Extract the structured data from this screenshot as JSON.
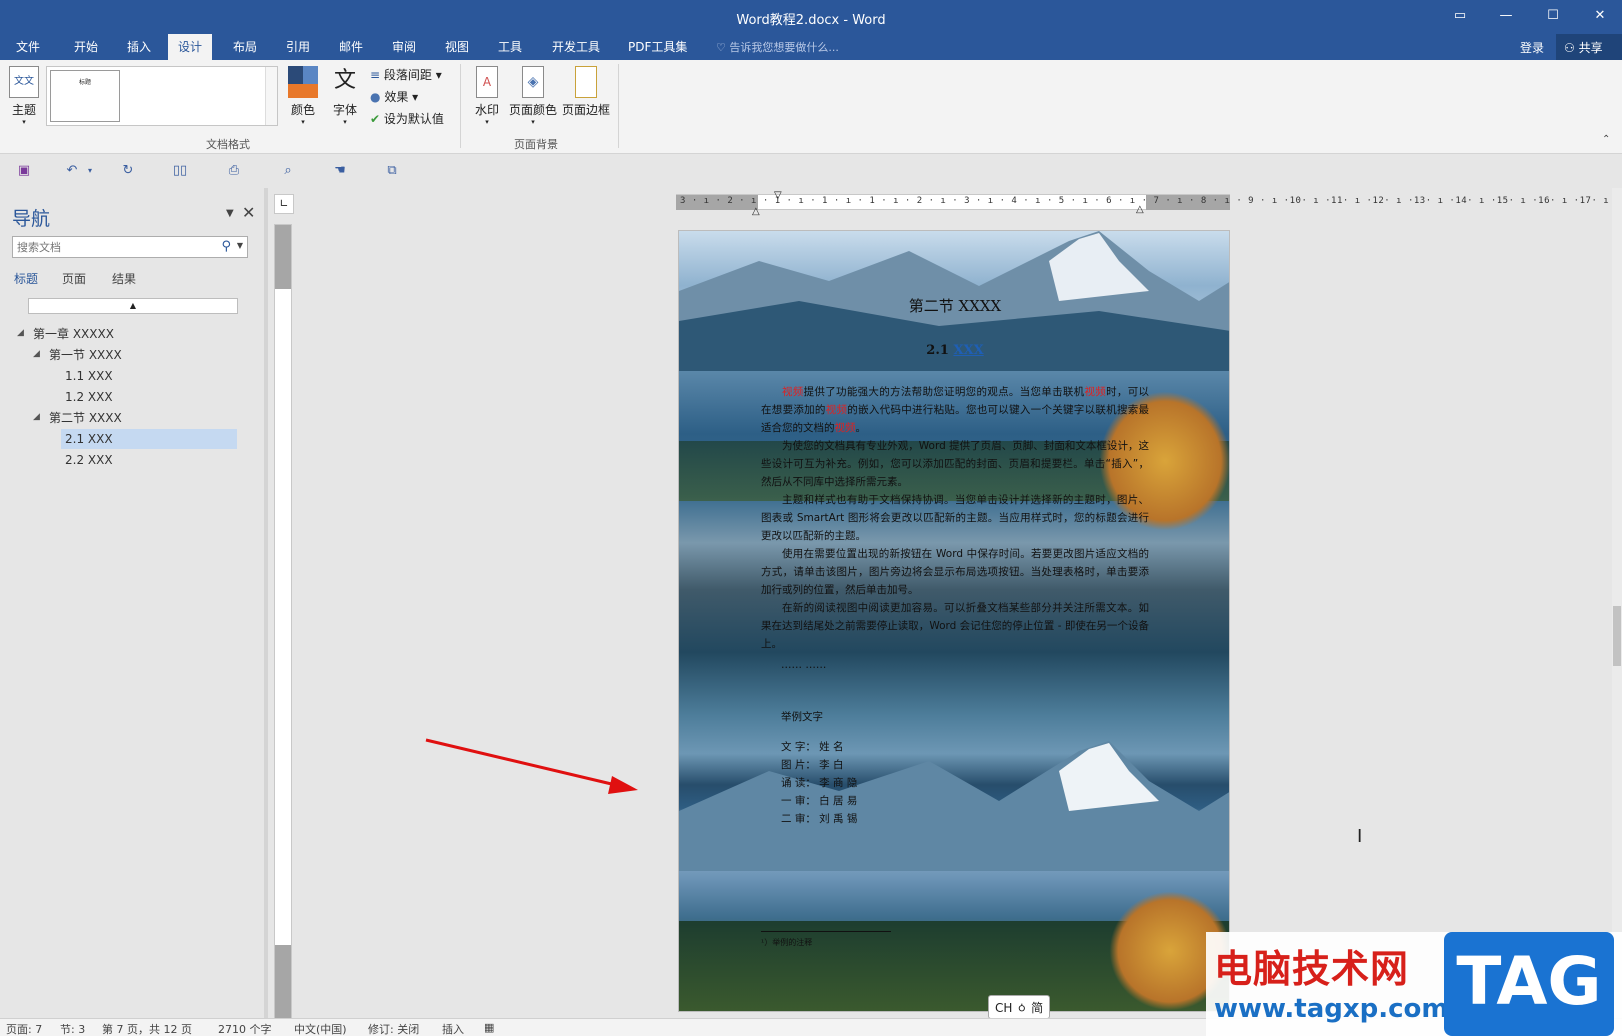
{
  "window": {
    "title": "Word教程2.docx - Word"
  },
  "menu": {
    "items": [
      "文件",
      "开始",
      "插入",
      "设计",
      "布局",
      "引用",
      "邮件",
      "审阅",
      "视图",
      "工具",
      "开发工具",
      "PDF工具集"
    ],
    "active": "设计",
    "tell_me": "告诉我您想要做什么...",
    "login": "登录",
    "share": "共享"
  },
  "ribbon": {
    "theme": "主题",
    "thumb_label": "标题",
    "colors": "颜色",
    "fonts": "字体",
    "para_spacing": "段落间距",
    "effects": "效果",
    "set_default": "设为默认值",
    "group_doc_format": "文档格式",
    "watermark": "水印",
    "page_color": "页面颜色",
    "page_border": "页面边框",
    "group_page_bg": "页面背景"
  },
  "nav": {
    "title": "导航",
    "search_placeholder": "搜索文档",
    "tabs": [
      "标题",
      "页面",
      "结果"
    ],
    "tree": [
      {
        "label": "第一章 XXXXX",
        "level": 0
      },
      {
        "label": "第一节 XXXX",
        "level": 1
      },
      {
        "label": "1.1 XXX",
        "level": 2
      },
      {
        "label": "1.2 XXX",
        "level": 2
      },
      {
        "label": "第二节 XXXX",
        "level": 1
      },
      {
        "label": "2.1 XXX",
        "level": 2,
        "selected": true
      },
      {
        "label": "2.2 XXX",
        "level": 2
      }
    ]
  },
  "ruler": {
    "h_text": "3 · ı · 2 · ı · 1 · ı · 1 · ı · 1 · ı · 2 · ı · 3 · ı · 4 · ı · 5 · ı · 6 · ı · 7 · ı · 8 · ı · 9 · ı ·10· ı ·11· ı ·12· ı ·13· ı ·14· ı ·15· ı ·16· ı ·17· ı ·"
  },
  "document": {
    "heading1": "第二节  XXXX",
    "heading2_num": "2.1 ",
    "heading2_link": "XXX",
    "para1_parts": [
      "视频",
      "提供了功能强大的方法帮助您证明您的观点。当您单击联机",
      "视频",
      "时，可以在想要添加的",
      "视频",
      "的嵌入代码中进行粘贴。您也可以键入一个关键字以联机搜索最适合您的文档的",
      "视频",
      "。"
    ],
    "para2": "为使您的文档具有专业外观，Word 提供了页眉、页脚、封面和文本框设计，这些设计可互为补充。例如，您可以添加匹配的封面、页眉和提要栏。单击“插入”，然后从不同库中选择所需元素。",
    "para3": "主题和样式也有助于文档保持协调。当您单击设计并选择新的主题时，图片、图表或 SmartArt 图形将会更改以匹配新的主题。当应用样式时，您的标题会进行更改以匹配新的主题。",
    "para4": "使用在需要位置出现的新按钮在 Word 中保存时间。若要更改图片适应文档的方式，请单击该图片，图片旁边将会显示布局选项按钮。当处理表格时，单击要添加行或列的位置，然后单击加号。",
    "para5": "在新的阅读视图中阅读更加容易。可以折叠文档某些部分并关注所需文本。如果在达到结尾处之前需要停止读取，Word 会记住您的停止位置 - 即使在另一个设备上。",
    "ellipsis": "……        ……",
    "example": "举例文字",
    "credits": [
      "文  字：  姓      名",
      "图  片：  李      白",
      "诵  读：  李  商  隐",
      "一  审：  白  居  易",
      "二  审：  刘  禹  锡"
    ],
    "footnote": "¹）举例的注释"
  },
  "status": {
    "page": "页面: 7",
    "section": "节: 3",
    "page_of": "第 7 页，共 12 页",
    "words": "2710 个字",
    "lang": "中文(中国)",
    "track": "修订: 关闭",
    "insert": "插入"
  },
  "ime": "CH ㆁ 简",
  "watermark": {
    "cn": "电脑技术网",
    "url": "www.tagxp.com",
    "tag": "TAG"
  }
}
